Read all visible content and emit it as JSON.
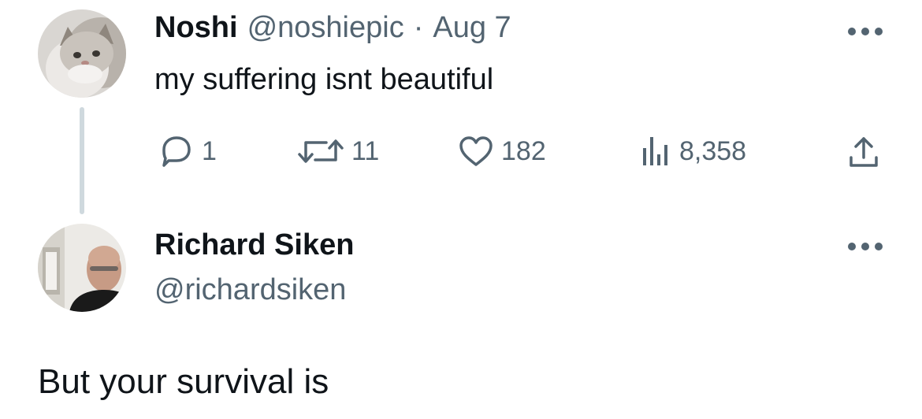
{
  "tweet_1": {
    "display_name": "Noshi",
    "handle": "@noshiepic",
    "separator": "·",
    "date": "Aug 7",
    "text": "my suffering isnt beautiful",
    "replies": "1",
    "reposts": "11",
    "likes": "182",
    "views": "8,358",
    "icons": {
      "avatar": "cat-avatar",
      "more": "more-dots-icon",
      "reply": "reply-bubble-icon",
      "repost": "repost-arrows-icon",
      "like": "heart-icon",
      "views": "bar-chart-icon",
      "share": "share-upload-icon"
    }
  },
  "tweet_2": {
    "display_name": "Richard Siken",
    "handle": "@richardsiken",
    "text": "But your survival is",
    "icons": {
      "avatar": "person-avatar",
      "more": "more-dots-icon"
    }
  },
  "colors": {
    "text_primary": "#0f1419",
    "text_secondary": "#536471",
    "thread_line": "#cfd9de",
    "background": "#ffffff"
  }
}
